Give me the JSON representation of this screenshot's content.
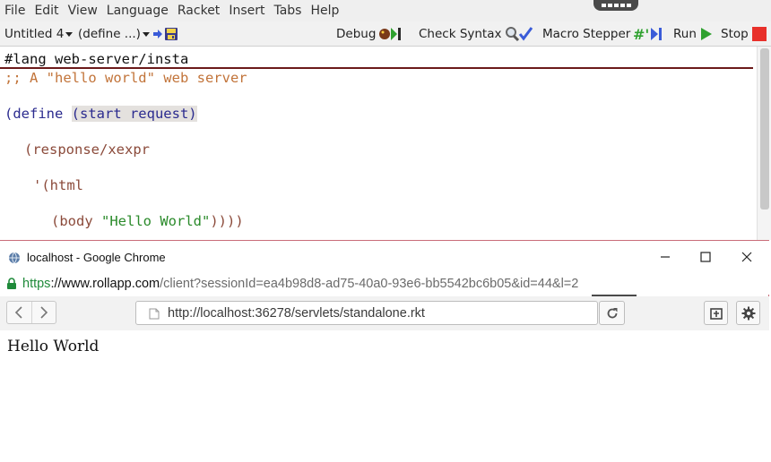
{
  "menubar": {
    "items": [
      "File",
      "Edit",
      "View",
      "Language",
      "Racket",
      "Insert",
      "Tabs",
      "Help"
    ]
  },
  "toolbar": {
    "file_name": "Untitled 4",
    "define_menu": "(define ...)",
    "debug_label": "Debug",
    "check_syntax_label": "Check Syntax",
    "macro_stepper_label": "Macro Stepper",
    "run_label": "Run",
    "stop_label": "Stop"
  },
  "editor": {
    "lang_line": "#lang web-server/insta",
    "comment_line": ";; A \"hello world\" web server",
    "define_open": "(define ",
    "define_sig": "(start request)",
    "response_line": "(response/xexpr",
    "html_line": "'(html",
    "body_open": "(body ",
    "body_string": "\"Hello World\"",
    "body_close": "))))"
  },
  "chrome": {
    "title": "localhost - Google Chrome",
    "url_scheme": "https",
    "url_host": "://www.rollapp.com",
    "url_path": "/client?sessionId=ea4b98d8-ad75-40a0-93e6-bb5542bc6b05&id=44&l=2",
    "address": "http://localhost:36278/servlets/standalone.rkt",
    "page_text": "Hello World"
  },
  "colors": {
    "stop_red": "#e8302a",
    "run_green": "#2fa12f",
    "secure_green": "#1f8a3a",
    "window_border": "#c96d7a"
  },
  "icons": [
    "save-icon",
    "arrow-right-icon",
    "bug-icon",
    "magnifier-check-icon",
    "macro-stepper-icon",
    "run-triangle-icon",
    "stop-square-icon",
    "globe-icon",
    "lock-icon",
    "back-icon",
    "forward-icon",
    "page-icon",
    "reload-icon",
    "extension-icon",
    "gear-icon",
    "minimize-icon",
    "maximize-icon",
    "close-icon"
  ]
}
